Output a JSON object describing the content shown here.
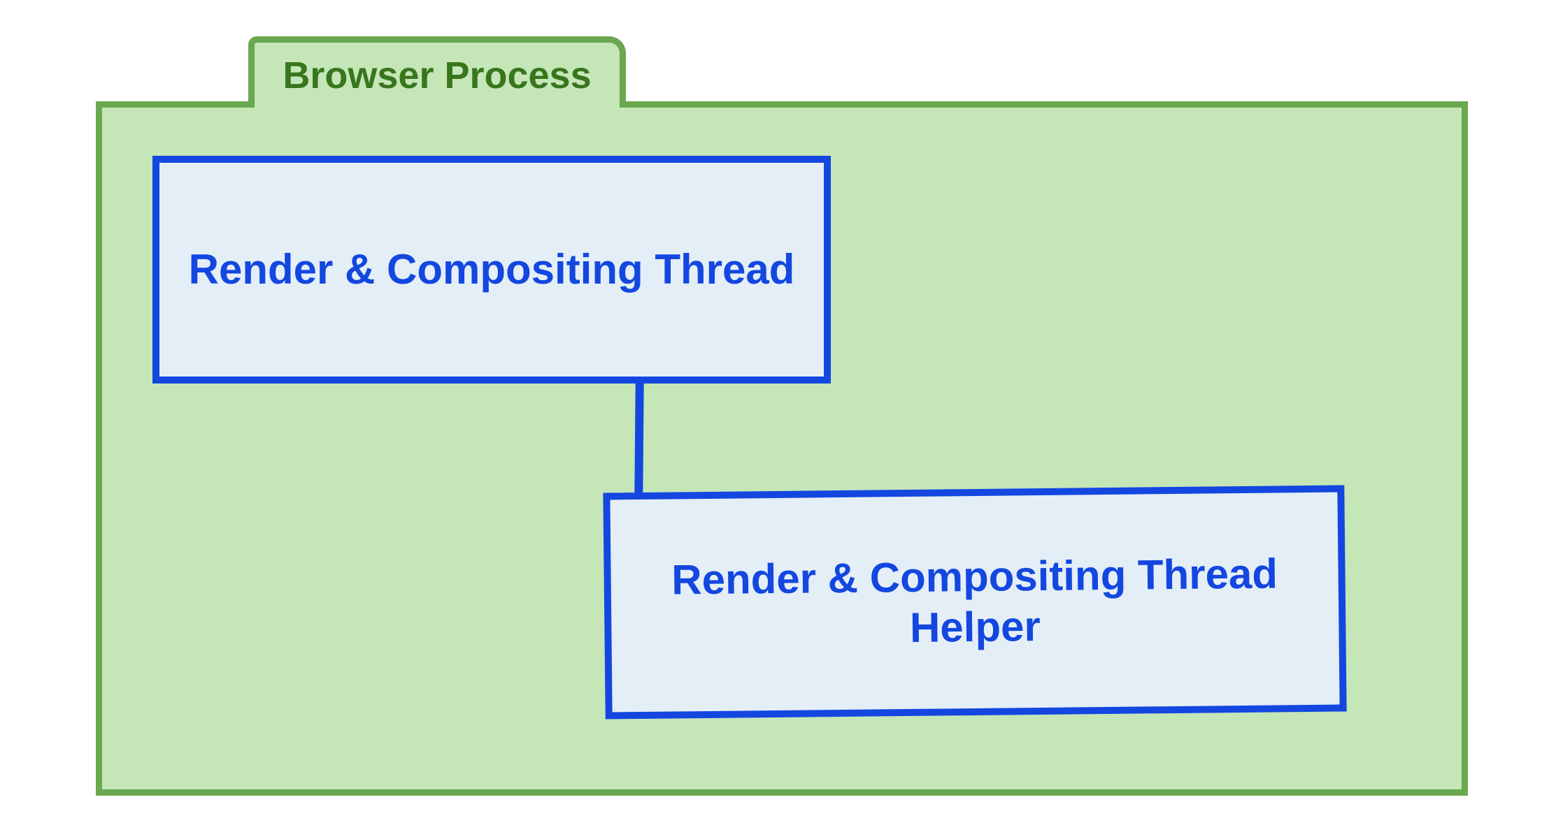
{
  "process": {
    "title": "Browser Process",
    "colors": {
      "border": "#6aa84f",
      "fill": "#c5e6b7",
      "title_text": "#38761d"
    },
    "threads": [
      {
        "id": "render-compositing-thread",
        "label": "Render & Compositing Thread"
      },
      {
        "id": "render-compositing-thread-helper",
        "label": "Render & Compositing Thread Helper"
      }
    ],
    "thread_colors": {
      "border": "#1347e0",
      "fill": "#e4eef6",
      "text": "#1347e0"
    },
    "connections": [
      {
        "from": "render-compositing-thread",
        "to": "render-compositing-thread-helper"
      }
    ]
  }
}
